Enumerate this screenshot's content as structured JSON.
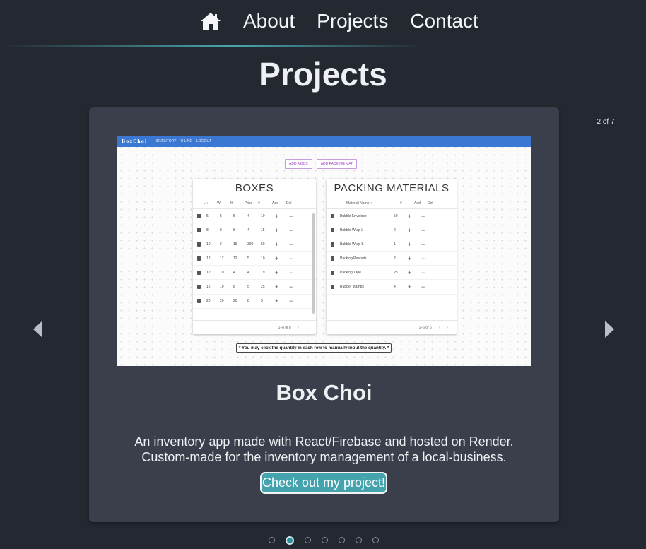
{
  "nav": {
    "home_icon": "home-icon",
    "links": [
      "About",
      "Projects",
      "Contact"
    ]
  },
  "page_title": "Projects",
  "carousel": {
    "counter": "2 of 7",
    "total": 7,
    "active_index": 1
  },
  "project": {
    "title": "Box Choi",
    "description_line1": "An inventory app made with React/Firebase and hosted on Render.",
    "description_line2": "Custom-made for the inventory management of a local-business.",
    "cta_label": "Check out my project!"
  },
  "screenshot": {
    "brand": "BoxChoi",
    "nav": [
      "INVENTORY",
      "U-LINE",
      "LOGOUT"
    ],
    "buttons": [
      "ADD A BOX",
      "ADD PACKING MAT"
    ],
    "boxes": {
      "title": "BOXES",
      "headers": [
        "L ↑",
        "W",
        "H",
        "Price",
        "#",
        "Add",
        "Del"
      ],
      "rows": [
        [
          "5",
          "5",
          "5",
          "4",
          "10"
        ],
        [
          "8",
          "8",
          "8",
          "4",
          "15"
        ],
        [
          "10",
          "6",
          "15",
          "300",
          "50"
        ],
        [
          "12",
          "12",
          "12",
          "5",
          "10"
        ],
        [
          "12",
          "10",
          "4",
          "4",
          "19"
        ],
        [
          "12",
          "10",
          "8",
          "5",
          "25"
        ],
        [
          "20",
          "20",
          "20",
          "8",
          "5"
        ]
      ],
      "footer": "1–8 of 8"
    },
    "materials": {
      "title": "PACKING MATERIALS",
      "headers": [
        "Material Name ↑",
        "#",
        "Add",
        "Del"
      ],
      "rows": [
        [
          "Bubble Envelope",
          "50"
        ],
        [
          "Bubble Wrap L",
          "2"
        ],
        [
          "Bubble Wrap S",
          "1"
        ],
        [
          "Packing Peanuts",
          "2"
        ],
        [
          "Packing Tape",
          "25"
        ],
        [
          "Rubber stamps",
          "4"
        ]
      ],
      "footer": "1–6 of 6"
    },
    "note": "* You may click the quantity in each row to manually input the quantity. *"
  }
}
